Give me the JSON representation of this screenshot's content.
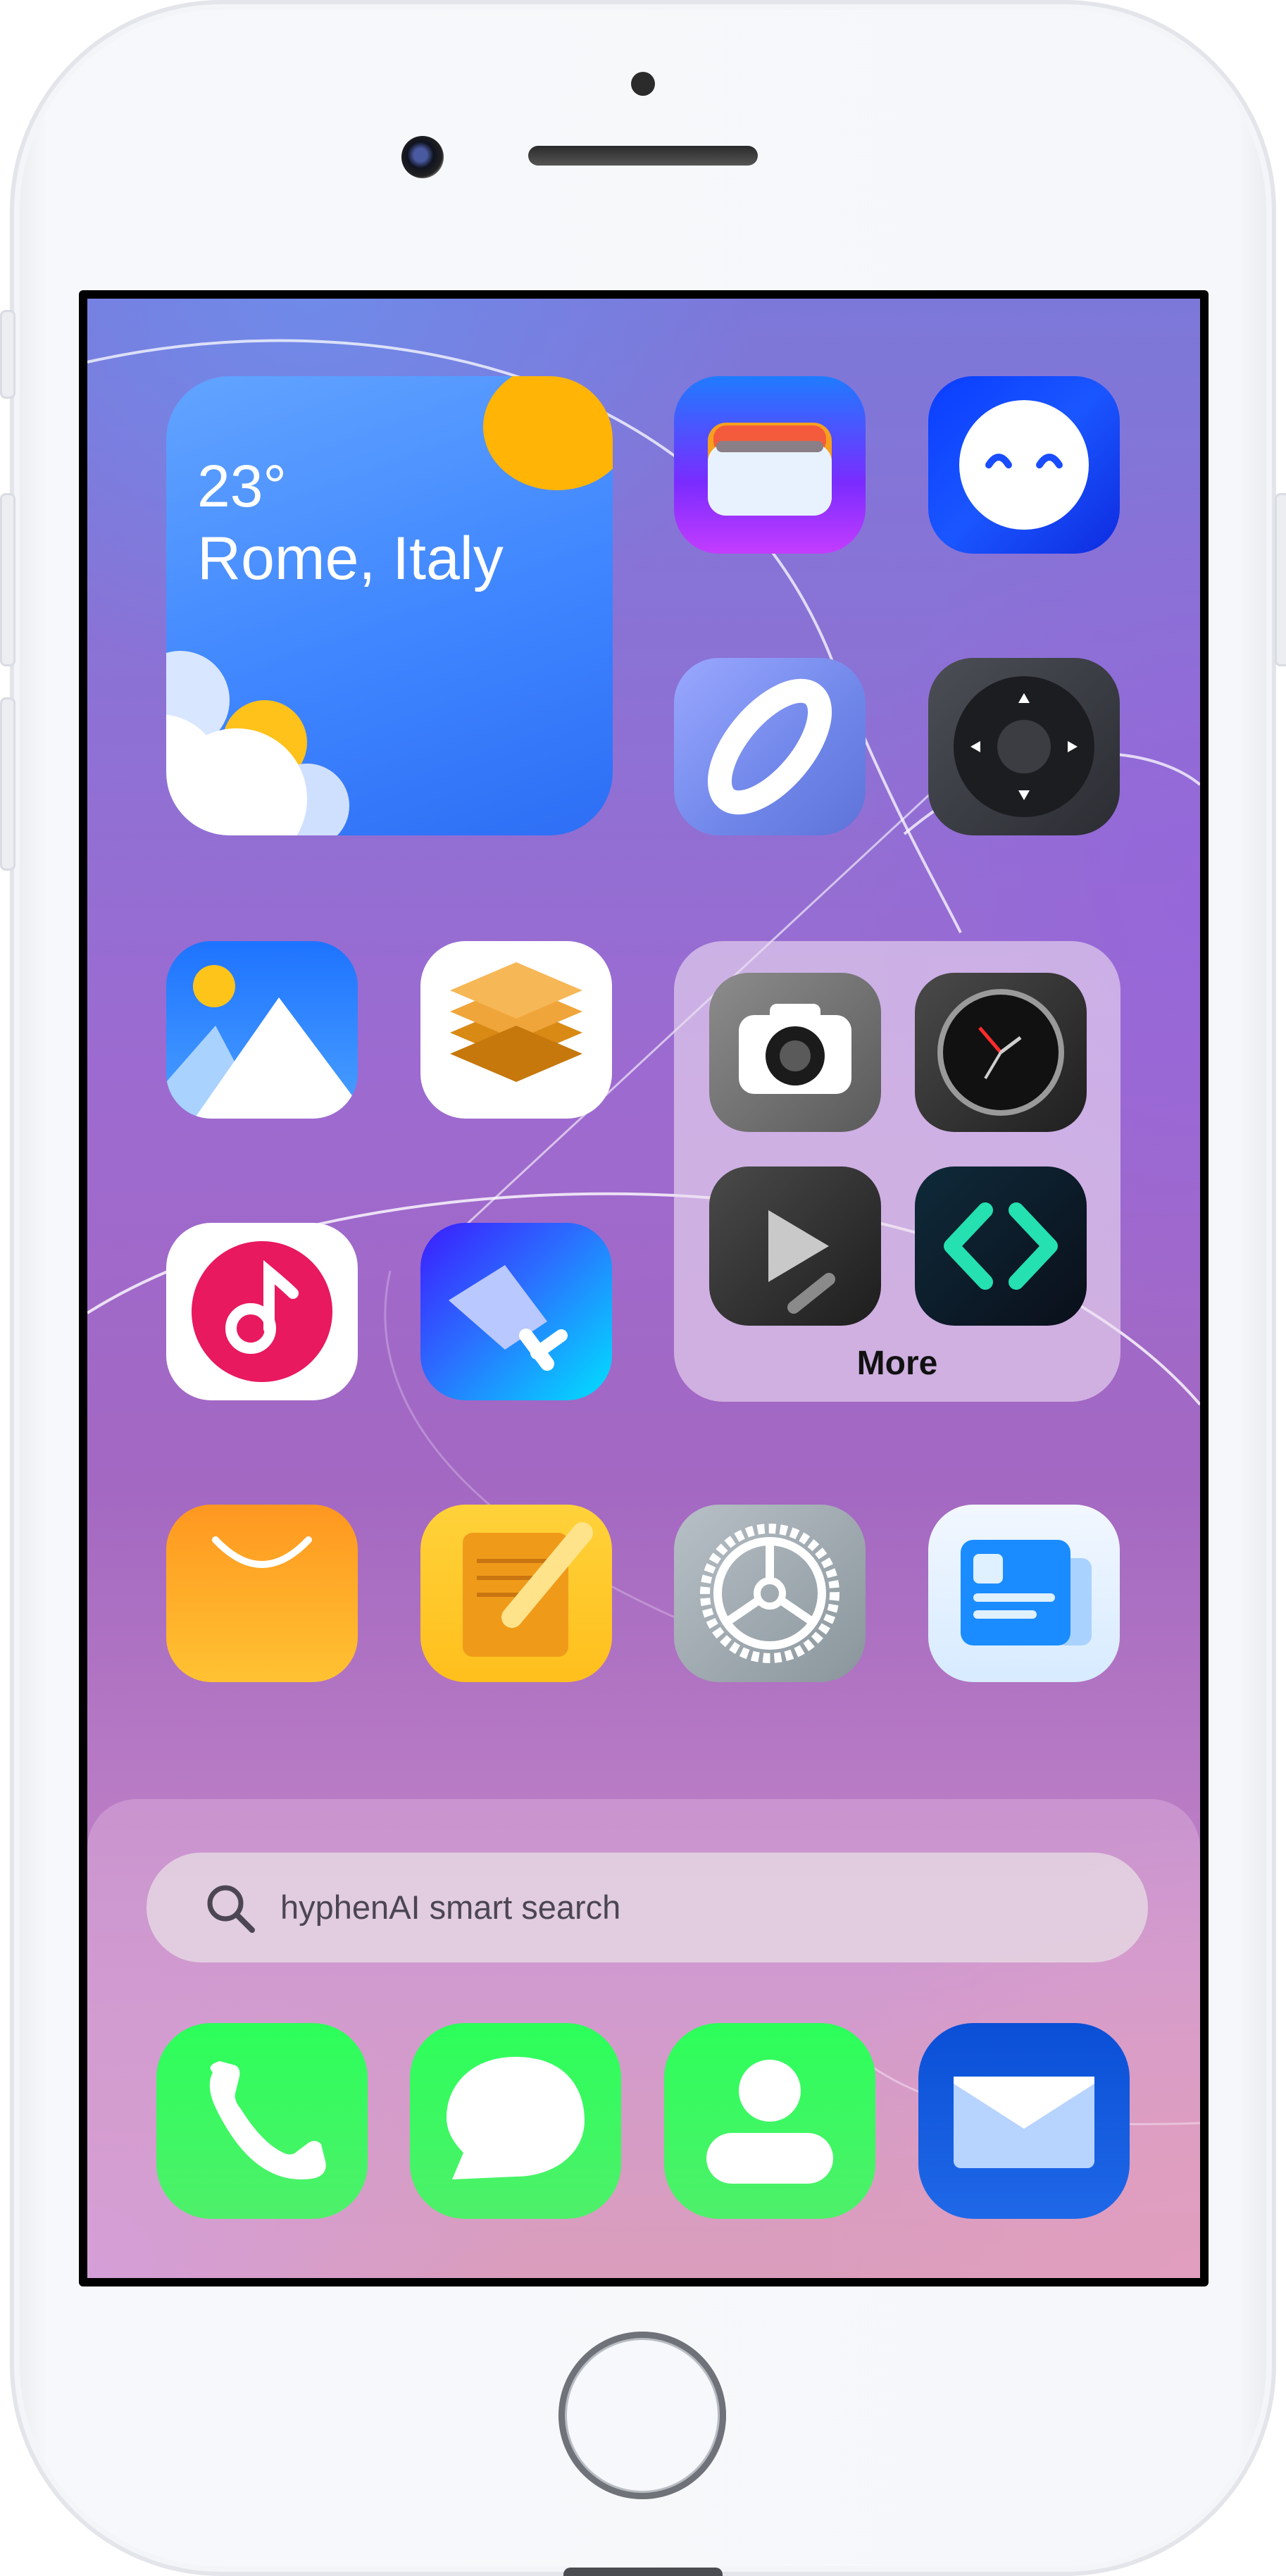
{
  "weather": {
    "temperature": "23°",
    "location": "Rome, Italy"
  },
  "apps": [
    {
      "icon": "wallet-icon"
    },
    {
      "icon": "smiley-chat-icon"
    },
    {
      "icon": "ring-icon"
    },
    {
      "icon": "remote-dpad-icon"
    },
    {
      "icon": "photos-icon"
    },
    {
      "icon": "layers-icon"
    },
    {
      "icon": "music-icon"
    },
    {
      "icon": "cleaner-icon"
    },
    {
      "icon": "store-icon"
    },
    {
      "icon": "notes-icon"
    },
    {
      "icon": "settings-icon"
    },
    {
      "icon": "news-icon"
    }
  ],
  "folder": {
    "label": "More",
    "apps": [
      {
        "icon": "camera-icon"
      },
      {
        "icon": "clock-icon"
      },
      {
        "icon": "video-player-icon"
      },
      {
        "icon": "code-icon"
      }
    ]
  },
  "search": {
    "placeholder": "hyphenAI smart search"
  },
  "dock": [
    {
      "icon": "phone-icon"
    },
    {
      "icon": "messages-icon"
    },
    {
      "icon": "contacts-icon"
    },
    {
      "icon": "mail-icon"
    }
  ]
}
